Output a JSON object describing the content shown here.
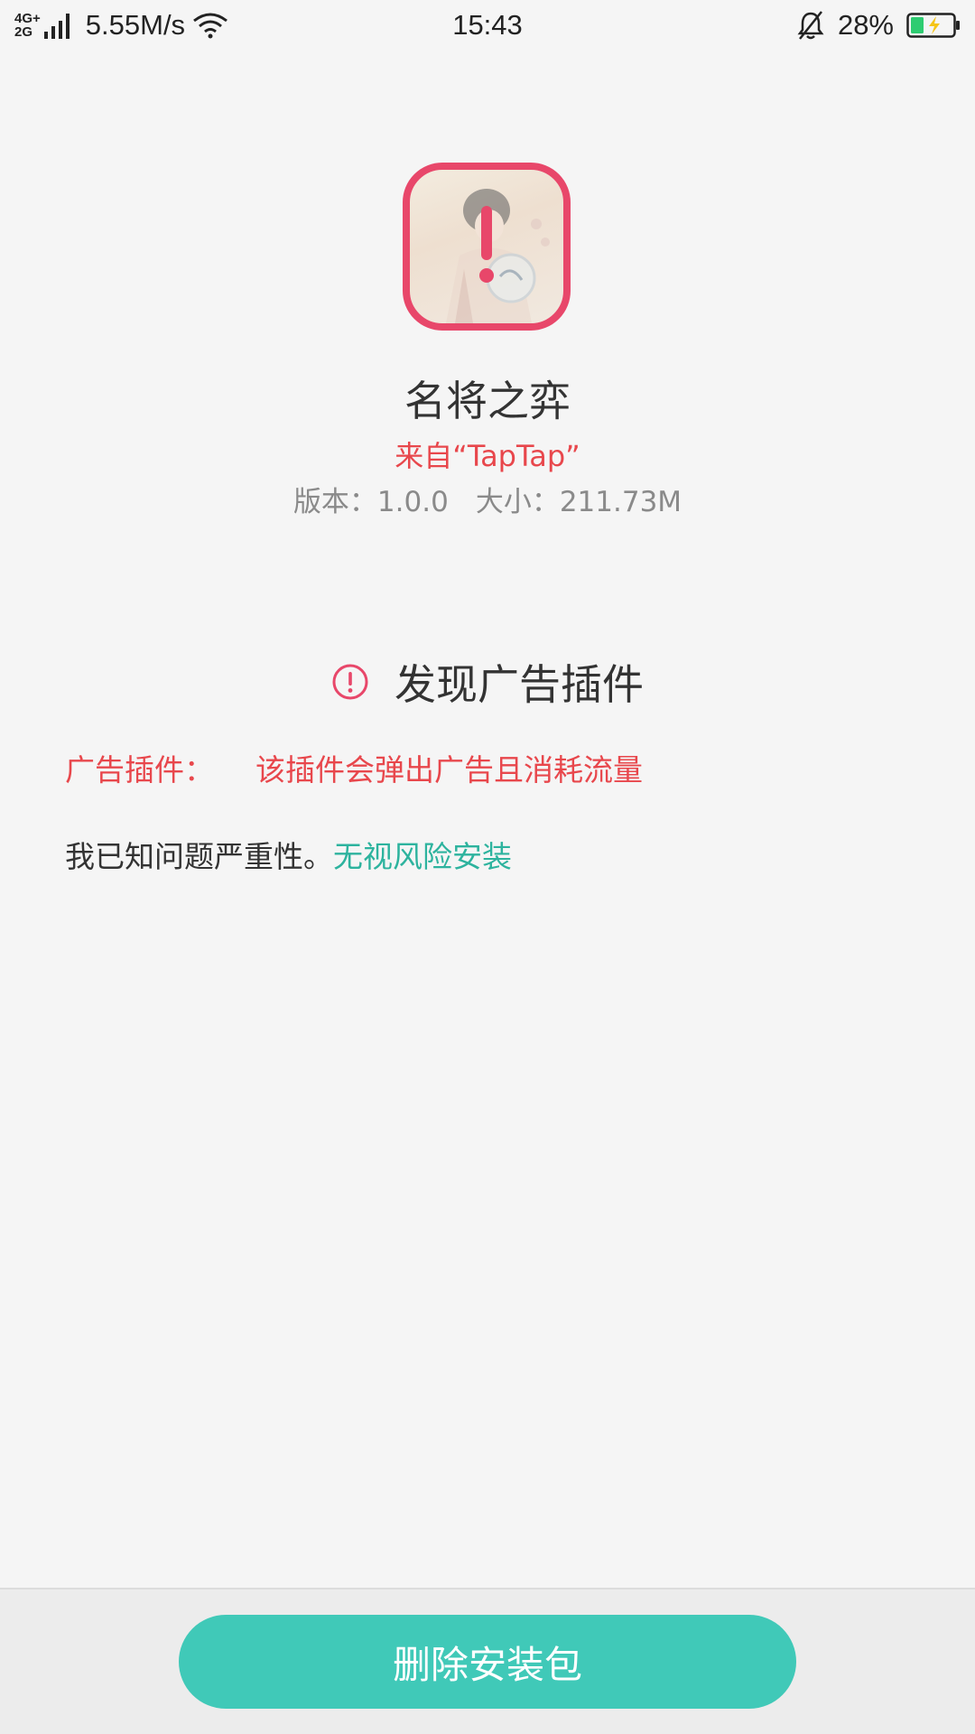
{
  "status_bar": {
    "network_top": "4G+",
    "network_bottom": "2G",
    "speed": "5.55M/s",
    "time": "15:43",
    "battery": "28%",
    "icons": [
      "signal-icon",
      "wifi-icon",
      "bell-off-icon",
      "battery-charging-icon"
    ]
  },
  "app": {
    "name": "名将之弈",
    "source": "来自“TapTap”",
    "version": "版本：1.0.0",
    "size": "大小：211.73M"
  },
  "warning": {
    "title": "发现广告插件",
    "plugin_label": "广告插件：",
    "plugin_desc": "该插件会弹出广告且消耗流量",
    "ack_text": "我已知问题严重性。",
    "ack_link": "无视风险安装"
  },
  "actions": {
    "delete_label": "删除安装包"
  },
  "colors": {
    "accent_red": "#e8476a",
    "warning_text": "#e8474c",
    "link_teal": "#2db39e",
    "button_teal": "#40c9b8"
  }
}
